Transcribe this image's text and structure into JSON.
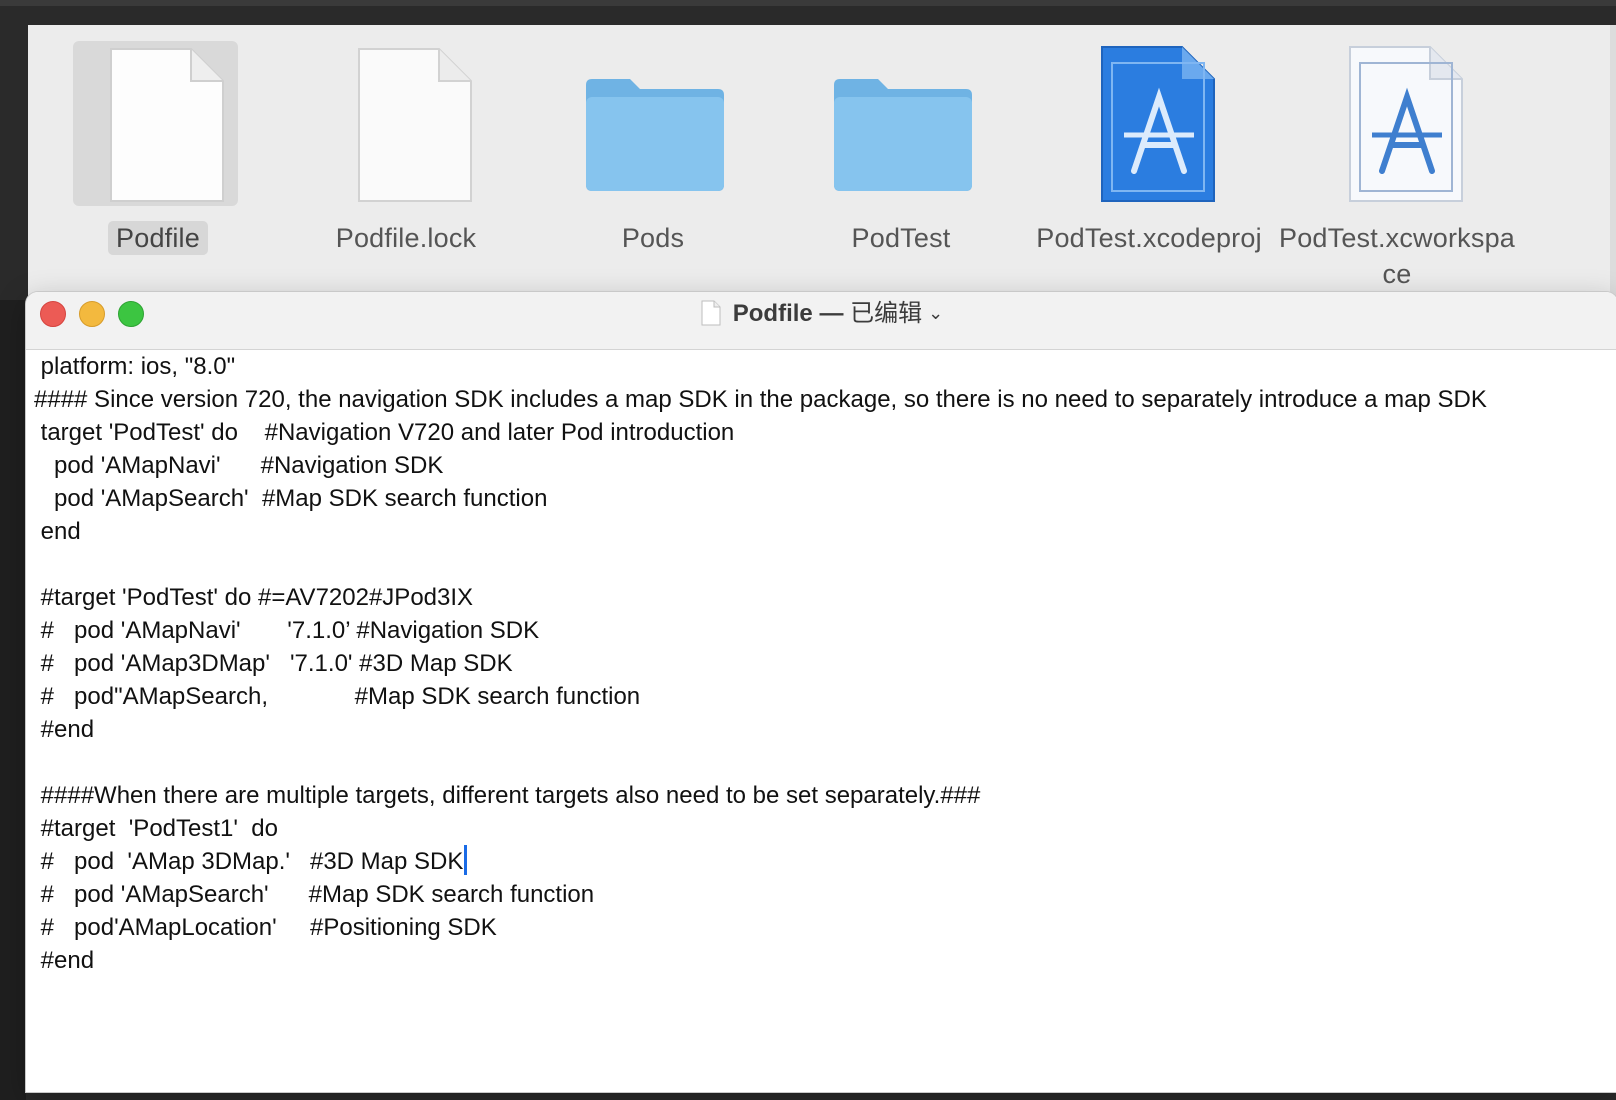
{
  "finder": {
    "items": [
      {
        "name": "Podfile",
        "kind": "document",
        "selected": true
      },
      {
        "name": "Podfile.lock",
        "kind": "document",
        "selected": false
      },
      {
        "name": "Pods",
        "kind": "folder",
        "selected": false
      },
      {
        "name": "PodTest",
        "kind": "folder",
        "selected": false
      },
      {
        "name": "PodTest.xcodeproj",
        "kind": "xcodeproj",
        "selected": false
      },
      {
        "name": "PodTest.xcworkspace",
        "kind": "xcworkspace",
        "selected": false
      }
    ]
  },
  "window": {
    "title": "Podfile",
    "title_sep": "—",
    "status": "已编辑",
    "chevron": "⌄"
  },
  "editor": {
    "lines": [
      " platform: ios, \"8.0\"",
      " #### Since version 720, the navigation SDK includes a map SDK in the package, so there is no need to separately introduce a map SDK",
      " target 'PodTest' do    #Navigation V720 and later Pod introduction",
      "   pod 'AMapNavi'      #Navigation SDK",
      "   pod 'AMapSearch'  #Map SDK search function",
      " end",
      "",
      " #target 'PodTest' do #=AV7202#JPod3IX",
      " #   pod 'AMapNavi'       '7.1.0’ #Navigation SDK",
      " #   pod 'AMap3DMap'   '7.1.0' #3D Map SDK",
      " #   pod\"AMapSearch,             #Map SDK search function",
      " #end",
      "",
      " ####When there are multiple targets, different targets also need to be set separately.###",
      " #target  'PodTest1'  do",
      " #   pod  'AMap 3DMap.'   #3D Map SDK",
      " #   pod 'AMapSearch'      #Map SDK search function",
      " #   pod'AMapLocation'     #Positioning SDK",
      " #end"
    ]
  },
  "colors": {
    "folder": "#7dbde9",
    "xcode_blue": "#2b7de0",
    "close": "#ec5b55",
    "minimize": "#f3b93e",
    "zoom": "#3cc541",
    "caret": "#1a6be6"
  }
}
